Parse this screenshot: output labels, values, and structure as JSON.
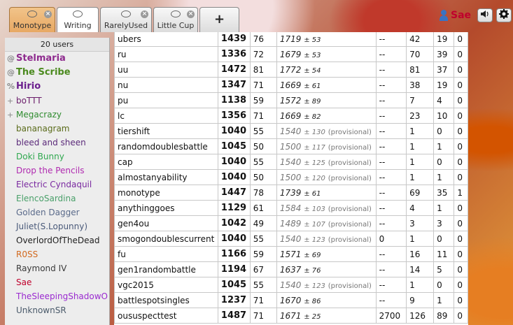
{
  "header": {
    "tabs": [
      {
        "label": "Monotype",
        "state": "active",
        "closable": true
      },
      {
        "label": "Writing",
        "state": "current",
        "closable": false
      },
      {
        "label": "RarelyUsed",
        "state": "normal",
        "closable": true
      },
      {
        "label": "Little Cup",
        "state": "normal",
        "closable": true
      }
    ],
    "new_tab_label": "+",
    "username": "Sae",
    "sound_icon": "speaker-icon",
    "settings_icon": "gear-icon"
  },
  "userlist": {
    "count_label": "20 users",
    "users": [
      {
        "rank": "@",
        "name": "Stelmaria",
        "color": "#8e2a8e",
        "bold": true
      },
      {
        "rank": "@",
        "name": "The Scribe",
        "color": "#4b8a1f",
        "bold": true
      },
      {
        "rank": "%",
        "name": "Hirio",
        "color": "#6b1f8e",
        "bold": true
      },
      {
        "rank": "+",
        "name": "boTTT",
        "color": "#6a1c6a",
        "bold": false
      },
      {
        "rank": "+",
        "name": "Megacrazy",
        "color": "#2e8b2e",
        "bold": false
      },
      {
        "rank": "",
        "name": "bananagram",
        "color": "#5a6b1a",
        "bold": false
      },
      {
        "rank": "",
        "name": "bleed and sheen",
        "color": "#5b2a7a",
        "bold": false
      },
      {
        "rank": "",
        "name": "Doki Bunny",
        "color": "#2fa84f",
        "bold": false
      },
      {
        "rank": "",
        "name": "Drop the Pencils",
        "color": "#b02ab0",
        "bold": false
      },
      {
        "rank": "",
        "name": "Electric Cyndaquil",
        "color": "#7a2aa0",
        "bold": false
      },
      {
        "rank": "",
        "name": "ElencoSardina",
        "color": "#4aa06a",
        "bold": false
      },
      {
        "rank": "",
        "name": "Golden Dagger",
        "color": "#5a6a8a",
        "bold": false
      },
      {
        "rank": "",
        "name": "Juliet(S.Lopunny)",
        "color": "#4a5a7a",
        "bold": false
      },
      {
        "rank": "",
        "name": "OverlordOfTheDead",
        "color": "#222222",
        "bold": false
      },
      {
        "rank": "",
        "name": "R0SS",
        "color": "#d2691e",
        "bold": false
      },
      {
        "rank": "",
        "name": "Raymond IV",
        "color": "#3a3a3a",
        "bold": false
      },
      {
        "rank": "",
        "name": "Sae",
        "color": "#c0002c",
        "bold": false
      },
      {
        "rank": "",
        "name": "TheSleepingShadowO",
        "color": "#9a2ad0",
        "bold": false
      },
      {
        "rank": "",
        "name": "UnknownSR",
        "color": "#4a5a6a",
        "bold": false
      }
    ]
  },
  "ladder": {
    "rows": [
      {
        "format": "ubers",
        "elo": "1439",
        "gxe": "76",
        "glicko": "1719",
        "dev": "± 53",
        "prov": false,
        "coil": "--",
        "w": "42",
        "l": "19",
        "t": "0"
      },
      {
        "format": "ru",
        "elo": "1336",
        "gxe": "72",
        "glicko": "1679",
        "dev": "± 53",
        "prov": false,
        "coil": "--",
        "w": "70",
        "l": "39",
        "t": "0"
      },
      {
        "format": "uu",
        "elo": "1472",
        "gxe": "81",
        "glicko": "1772",
        "dev": "± 54",
        "prov": false,
        "coil": "--",
        "w": "81",
        "l": "37",
        "t": "0"
      },
      {
        "format": "nu",
        "elo": "1347",
        "gxe": "71",
        "glicko": "1669",
        "dev": "± 61",
        "prov": false,
        "coil": "--",
        "w": "38",
        "l": "19",
        "t": "0"
      },
      {
        "format": "pu",
        "elo": "1138",
        "gxe": "59",
        "glicko": "1572",
        "dev": "± 89",
        "prov": false,
        "coil": "--",
        "w": "7",
        "l": "4",
        "t": "0"
      },
      {
        "format": "lc",
        "elo": "1356",
        "gxe": "71",
        "glicko": "1669",
        "dev": "± 82",
        "prov": false,
        "coil": "--",
        "w": "23",
        "l": "10",
        "t": "0"
      },
      {
        "format": "tiershift",
        "elo": "1040",
        "gxe": "55",
        "glicko": "1540",
        "dev": "± 130",
        "prov": true,
        "coil": "--",
        "w": "1",
        "l": "0",
        "t": "0"
      },
      {
        "format": "randomdoublesbattle",
        "elo": "1045",
        "gxe": "50",
        "glicko": "1500",
        "dev": "± 117",
        "prov": true,
        "coil": "--",
        "w": "1",
        "l": "1",
        "t": "0"
      },
      {
        "format": "cap",
        "elo": "1040",
        "gxe": "55",
        "glicko": "1540",
        "dev": "± 125",
        "prov": true,
        "coil": "--",
        "w": "1",
        "l": "0",
        "t": "0"
      },
      {
        "format": "almostanyability",
        "elo": "1040",
        "gxe": "50",
        "glicko": "1500",
        "dev": "± 120",
        "prov": true,
        "coil": "--",
        "w": "1",
        "l": "1",
        "t": "0"
      },
      {
        "format": "monotype",
        "elo": "1447",
        "gxe": "78",
        "glicko": "1739",
        "dev": "± 61",
        "prov": false,
        "coil": "--",
        "w": "69",
        "l": "35",
        "t": "1"
      },
      {
        "format": "anythinggoes",
        "elo": "1129",
        "gxe": "61",
        "glicko": "1584",
        "dev": "± 103",
        "prov": true,
        "coil": "--",
        "w": "4",
        "l": "1",
        "t": "0"
      },
      {
        "format": "gen4ou",
        "elo": "1042",
        "gxe": "49",
        "glicko": "1489",
        "dev": "± 107",
        "prov": true,
        "coil": "--",
        "w": "3",
        "l": "3",
        "t": "0"
      },
      {
        "format": "smogondoublescurrent",
        "elo": "1040",
        "gxe": "55",
        "glicko": "1540",
        "dev": "± 123",
        "prov": true,
        "coil": "0",
        "w": "1",
        "l": "0",
        "t": "0"
      },
      {
        "format": "fu",
        "elo": "1166",
        "gxe": "59",
        "glicko": "1571",
        "dev": "± 69",
        "prov": false,
        "coil": "--",
        "w": "16",
        "l": "11",
        "t": "0"
      },
      {
        "format": "gen1randombattle",
        "elo": "1194",
        "gxe": "67",
        "glicko": "1637",
        "dev": "± 76",
        "prov": false,
        "coil": "--",
        "w": "14",
        "l": "5",
        "t": "0"
      },
      {
        "format": "vgc2015",
        "elo": "1045",
        "gxe": "55",
        "glicko": "1540",
        "dev": "± 123",
        "prov": true,
        "coil": "--",
        "w": "1",
        "l": "0",
        "t": "0"
      },
      {
        "format": "battlespotsingles",
        "elo": "1237",
        "gxe": "71",
        "glicko": "1670",
        "dev": "± 86",
        "prov": false,
        "coil": "--",
        "w": "9",
        "l": "1",
        "t": "0"
      },
      {
        "format": "oususpecttest",
        "elo": "1487",
        "gxe": "71",
        "glicko": "1671",
        "dev": "± 25",
        "prov": false,
        "coil": "2700",
        "w": "126",
        "l": "89",
        "t": "0"
      }
    ],
    "provisional_label": "(provisional)"
  }
}
